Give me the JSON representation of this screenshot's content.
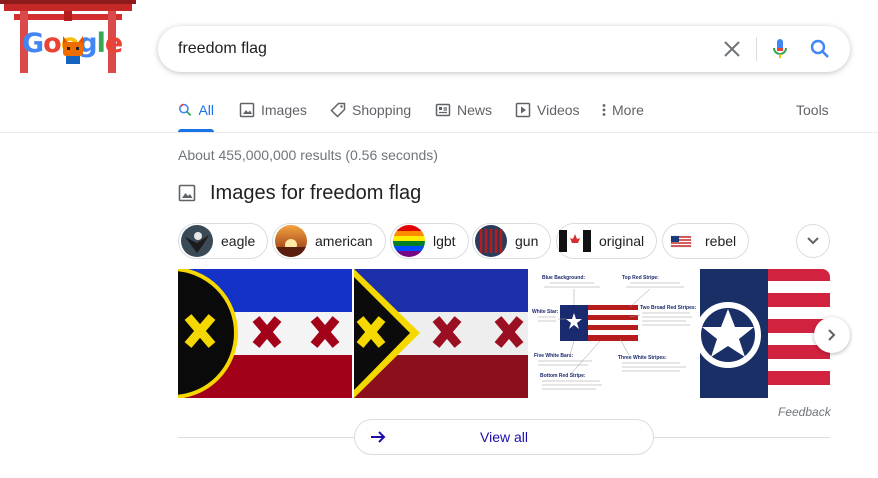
{
  "logo": {
    "text": "Google"
  },
  "search": {
    "query": "freedom flag"
  },
  "tabs": [
    {
      "label": "All",
      "icon": "search-icon"
    },
    {
      "label": "Images",
      "icon": "image-icon"
    },
    {
      "label": "Shopping",
      "icon": "tag-icon"
    },
    {
      "label": "News",
      "icon": "news-icon"
    },
    {
      "label": "Videos",
      "icon": "play-icon"
    },
    {
      "label": "More",
      "icon": "more-vert-icon"
    }
  ],
  "tools_label": "Tools",
  "result_stats": "About 455,000,000 results (0.56 seconds)",
  "images_header": "Images for freedom flag",
  "chips": [
    {
      "label": "eagle"
    },
    {
      "label": "american"
    },
    {
      "label": "lgbt"
    },
    {
      "label": "gun"
    },
    {
      "label": "original"
    },
    {
      "label": "rebel"
    }
  ],
  "infographic": {
    "blue_bg": "Blue Background:",
    "top_red": "Top Red Stripe:",
    "white_star": "White Star:",
    "two_red": "Two Broad Red Stripes:",
    "five_bars": "Five White Bars:",
    "three_white": "Three White Stripes:",
    "bottom_red": "Bottom Red Stripe:"
  },
  "feedback_label": "Feedback",
  "view_all_label": "View all",
  "colors": {
    "accent": "#1a73e8",
    "link": "#1a0dab",
    "text": "#202124",
    "muted": "#70757a"
  }
}
